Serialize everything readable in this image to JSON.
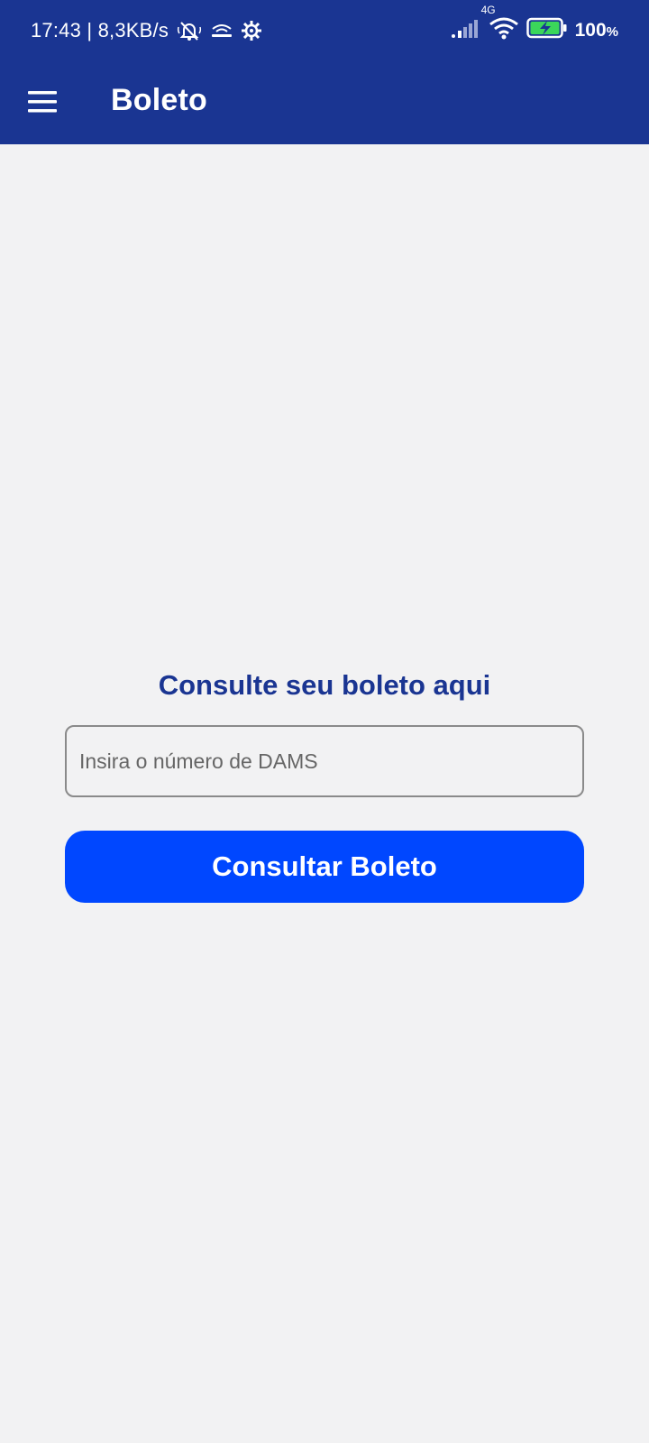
{
  "status_bar": {
    "time_speed": "17:43 | 8,3KB/s",
    "network": "4G",
    "battery": "100",
    "battery_unit": "%",
    "icons": [
      "muted-alarm-icon",
      "vowifi-icon",
      "gear-icon",
      "signal-icon",
      "wifi-icon",
      "battery-charging-icon"
    ]
  },
  "app_bar": {
    "title": "Boleto",
    "menu_icon": "menu-icon"
  },
  "main": {
    "heading": "Consulte seu boleto aqui",
    "dams_input": {
      "placeholder": "Insira o número de DAMS",
      "value": ""
    },
    "submit_label": "Consultar Boleto"
  },
  "colors": {
    "primary_dark": "#1a3592",
    "primary_button": "#0047ff",
    "background": "#f2f2f3",
    "battery_fill": "#3bd65a"
  }
}
